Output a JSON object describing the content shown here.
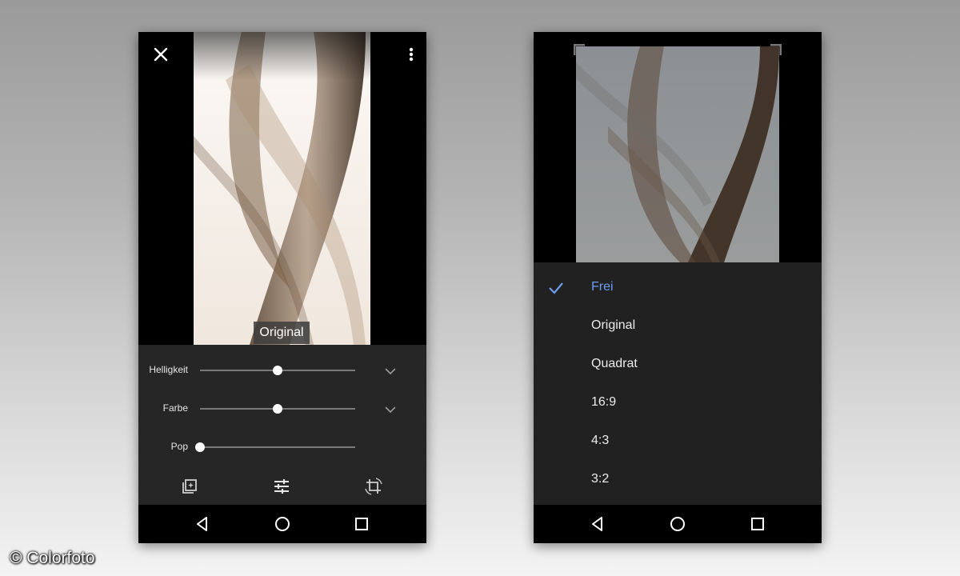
{
  "editor": {
    "compare_label": "Original",
    "adjustments": [
      {
        "label": "Helligkeit",
        "value": 0.5,
        "expandable": true
      },
      {
        "label": "Farbe",
        "value": 0.5,
        "expandable": true
      },
      {
        "label": "Pop",
        "value": 0.0,
        "expandable": false
      }
    ],
    "icons": {
      "close": "close-icon",
      "menu": "more-vert-icon",
      "filters": "auto-enhance-icon",
      "tune": "tune-icon",
      "crop": "crop-rotate-icon"
    }
  },
  "crop_menu": {
    "options": [
      {
        "label": "Frei",
        "selected": true
      },
      {
        "label": "Original",
        "selected": false
      },
      {
        "label": "Quadrat",
        "selected": false
      },
      {
        "label": "16:9",
        "selected": false
      },
      {
        "label": "4:3",
        "selected": false
      },
      {
        "label": "3:2",
        "selected": false
      }
    ],
    "accent_color": "#6e9ef0"
  },
  "navbar": {
    "icons": [
      "back-icon",
      "home-icon",
      "recents-icon"
    ]
  },
  "watermark": "© Colorfoto"
}
